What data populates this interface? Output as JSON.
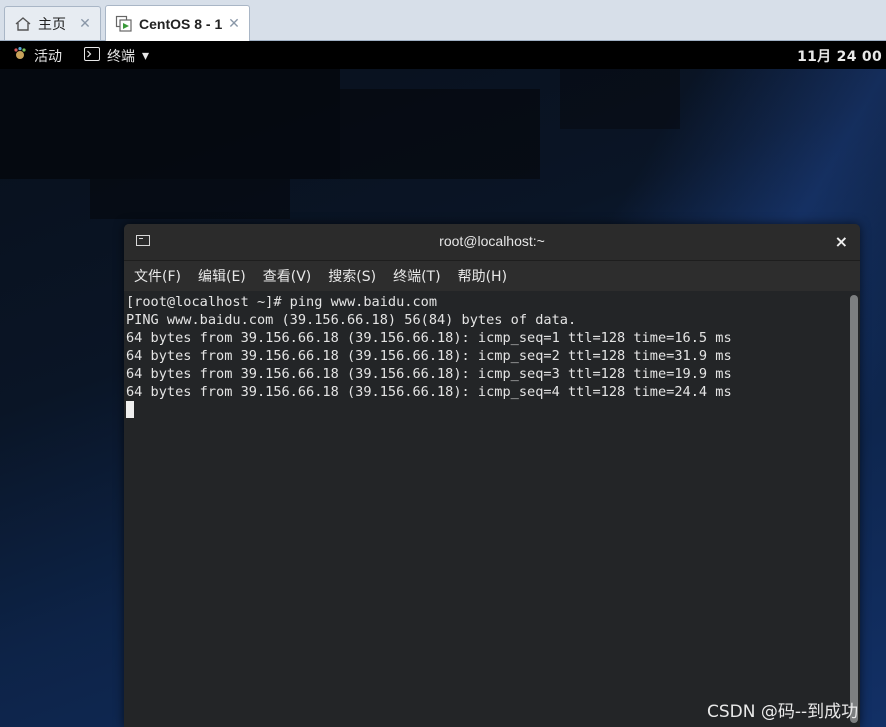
{
  "tabs": [
    {
      "label": "主页",
      "icon": "home-icon"
    },
    {
      "label": "CentOS 8 - 1",
      "icon": "vm-icon"
    }
  ],
  "tab_close_glyph": "✕",
  "gnome_bar": {
    "activities_label": "活动",
    "app_menu_label": "终端",
    "app_menu_arrow": "▾",
    "clock": "11月 24 00"
  },
  "terminal": {
    "title": "root@localhost:~",
    "close_glyph": "×",
    "menu": [
      "文件(F)",
      "编辑(E)",
      "查看(V)",
      "搜索(S)",
      "终端(T)",
      "帮助(H)"
    ],
    "lines": [
      "[root@localhost ~]# ping www.baidu.com",
      "PING www.baidu.com (39.156.66.18) 56(84) bytes of data.",
      "64 bytes from 39.156.66.18 (39.156.66.18): icmp_seq=1 ttl=128 time=16.5 ms",
      "64 bytes from 39.156.66.18 (39.156.66.18): icmp_seq=2 ttl=128 time=31.9 ms",
      "64 bytes from 39.156.66.18 (39.156.66.18): icmp_seq=3 ttl=128 time=19.9 ms",
      "64 bytes from 39.156.66.18 (39.156.66.18): icmp_seq=4 ttl=128 time=24.4 ms"
    ]
  },
  "watermark": "CSDN @码--到成功",
  "colors": {
    "terminal_bg": "#232527",
    "terminal_text": "#e4e4e4",
    "titlebar_bg": "#2b2b2b",
    "topbar_bg": "#000000",
    "tabstrip_bg": "#d7dfe9"
  }
}
